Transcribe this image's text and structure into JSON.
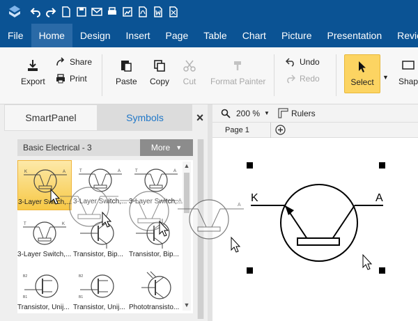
{
  "menu": {
    "items": [
      "File",
      "Home",
      "Design",
      "Insert",
      "Page",
      "Table",
      "Chart",
      "Picture",
      "Presentation",
      "Revie"
    ],
    "active": "Home"
  },
  "ribbon": {
    "export": "Export",
    "share": "Share",
    "print": "Print",
    "paste": "Paste",
    "copy": "Copy",
    "cut": "Cut",
    "format_painter": "Format Painter",
    "undo": "Undo",
    "redo": "Redo",
    "select": "Select",
    "shape": "Shap"
  },
  "panel": {
    "tab_smart": "SmartPanel",
    "tab_symbols": "Symbols",
    "close": "×",
    "library_title": "Basic Electrical - 3",
    "more": "More",
    "items": [
      {
        "label": "3-Layer Switch,..."
      },
      {
        "label": "3-Layer Switch,..."
      },
      {
        "label": "3-Layer Switch,..."
      },
      {
        "label": "3-Layer Switch,..."
      },
      {
        "label": "Transistor, Bip..."
      },
      {
        "label": "Transistor, Bip..."
      },
      {
        "label": "Transistor, Unij..."
      },
      {
        "label": "Transistor, Unij..."
      },
      {
        "label": "Phototransisto..."
      }
    ]
  },
  "canvas": {
    "zoom": "200 %",
    "rulers": "Rulers",
    "page_tab": "Page 1",
    "label_k": "K",
    "label_a": "A"
  },
  "colors": {
    "title_bar": "#0b5394",
    "select_highlight": "#fcd462",
    "accent_text": "#1f77c8"
  }
}
